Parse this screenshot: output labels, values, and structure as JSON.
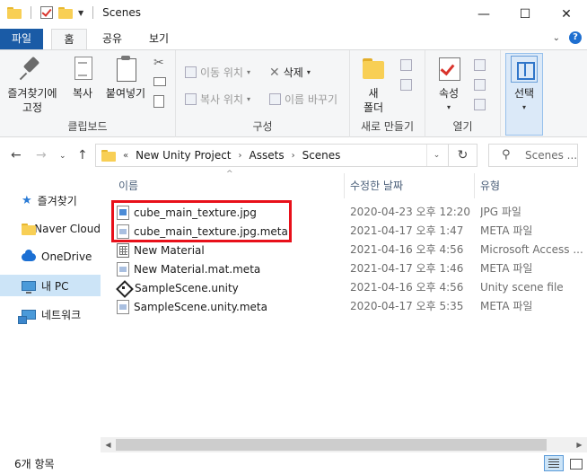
{
  "window": {
    "title": "Scenes",
    "controls": {
      "minimize": "—",
      "maximize": "☐",
      "close": "✕"
    }
  },
  "ribbon_tabs": [
    {
      "label": "파일"
    },
    {
      "label": "홈"
    },
    {
      "label": "공유"
    },
    {
      "label": "보기"
    }
  ],
  "ribbon": {
    "clipboard": {
      "pin_label": "즐겨찾기에\n고정",
      "copy_label": "복사",
      "paste_label": "붙여넣기",
      "group_label": "클립보드"
    },
    "organize": {
      "move_to": "이동 위치",
      "copy_to": "복사 위치",
      "delete": "삭제",
      "rename": "이름 바꾸기",
      "group_label": "구성"
    },
    "new": {
      "new_folder": "새\n폴더",
      "group_label": "새로 만들기"
    },
    "open": {
      "properties": "속성",
      "group_label": "열기"
    },
    "select": {
      "label": "선택"
    }
  },
  "address": {
    "prefix": "«",
    "crumbs": [
      "New Unity Project",
      "Assets",
      "Scenes"
    ],
    "search_placeholder": "Scenes ..."
  },
  "nav_pane": [
    {
      "label": "즐겨찾기",
      "icon": "star-icon"
    },
    {
      "label": "Naver Cloud",
      "icon": "folder-icon"
    },
    {
      "label": "OneDrive",
      "icon": "cloud-icon"
    },
    {
      "label": "내 PC",
      "icon": "pc-icon",
      "selected": true
    },
    {
      "label": "네트워크",
      "icon": "network-icon"
    }
  ],
  "columns": {
    "name": "이름",
    "date": "수정한 날짜",
    "type": "유형"
  },
  "files": [
    {
      "name": "cube_main_texture.jpg",
      "date": "2020-04-23 오후 12:20",
      "type": "JPG 파일",
      "icon": "image-file-icon"
    },
    {
      "name": "cube_main_texture.jpg.meta",
      "date": "2021-04-17 오후 1:47",
      "type": "META 파일",
      "icon": "meta-file-icon"
    },
    {
      "name": "New Material",
      "date": "2021-04-16 오후 4:56",
      "type": "Microsoft Access ...",
      "icon": "access-file-icon"
    },
    {
      "name": "New Material.mat.meta",
      "date": "2021-04-17 오후 1:46",
      "type": "META 파일",
      "icon": "meta-file-icon"
    },
    {
      "name": "SampleScene.unity",
      "date": "2021-04-16 오후 4:56",
      "type": "Unity scene file",
      "icon": "unity-file-icon"
    },
    {
      "name": "SampleScene.unity.meta",
      "date": "2020-04-17 오후 5:35",
      "type": "META 파일",
      "icon": "meta-file-icon"
    }
  ],
  "status": {
    "item_count": "6개 항목"
  },
  "colors": {
    "file_tab": "#1a5ba6",
    "selection": "#cce4f7",
    "highlight_box": "#e8101a"
  }
}
